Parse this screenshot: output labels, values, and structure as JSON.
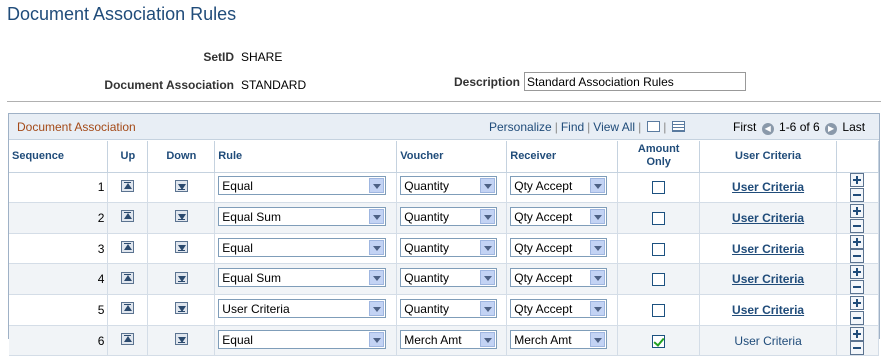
{
  "page": {
    "title": "Document Association Rules"
  },
  "header": {
    "setid_label": "SetID",
    "setid_value": "SHARE",
    "doc_assoc_label": "Document Association",
    "doc_assoc_value": "STANDARD",
    "description_label": "Description",
    "description_value": "Standard Association Rules"
  },
  "grid": {
    "title": "Document Association",
    "personalize": "Personalize",
    "find": "Find",
    "view_all": "View All",
    "first": "First",
    "range": "1-6 of 6",
    "last": "Last",
    "columns": {
      "sequence": "Sequence",
      "up": "Up",
      "down": "Down",
      "rule": "Rule",
      "voucher": "Voucher",
      "receiver": "Receiver",
      "amount_only": "Amount Only",
      "user_criteria": "User Criteria"
    },
    "rows": [
      {
        "seq": "1",
        "rule": "Equal",
        "voucher": "Quantity",
        "receiver": "Qty Accept",
        "amount_only": false,
        "user_criteria": "User Criteria"
      },
      {
        "seq": "2",
        "rule": "Equal Sum",
        "voucher": "Quantity",
        "receiver": "Qty Accept",
        "amount_only": false,
        "user_criteria": "User Criteria"
      },
      {
        "seq": "3",
        "rule": "Equal",
        "voucher": "Quantity",
        "receiver": "Qty Accept",
        "amount_only": false,
        "user_criteria": "User Criteria"
      },
      {
        "seq": "4",
        "rule": "Equal Sum",
        "voucher": "Quantity",
        "receiver": "Qty Accept",
        "amount_only": false,
        "user_criteria": "User Criteria"
      },
      {
        "seq": "5",
        "rule": "User Criteria",
        "voucher": "Quantity",
        "receiver": "Qty Accept",
        "amount_only": false,
        "user_criteria": "User Criteria"
      },
      {
        "seq": "6",
        "rule": "Equal",
        "voucher": "Merch Amt",
        "receiver": "Merch Amt",
        "amount_only": true,
        "user_criteria": "User Criteria"
      }
    ]
  }
}
